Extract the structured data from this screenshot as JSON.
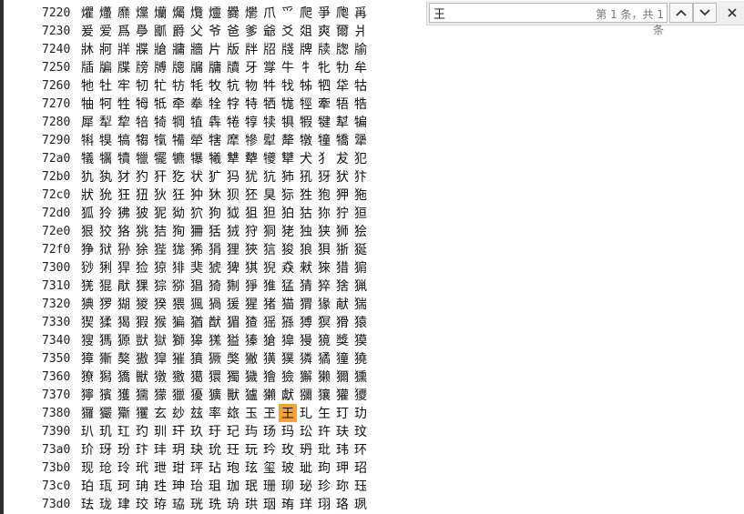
{
  "find_bar": {
    "query": "王",
    "match_count": "第 1 条，共 1 条",
    "icons": {
      "prev": "chevron-up-icon",
      "next": "chevron-down-icon",
      "close": "close-icon"
    }
  },
  "highlight_color": "#f6a23a",
  "table": {
    "rows": [
      {
        "code": "7220",
        "chars": [
          "爠",
          "爡",
          "爢",
          "爣",
          "爤",
          "爥",
          "爦",
          "爧",
          "爨",
          "爩",
          "爪",
          "爫",
          "爬",
          "爭",
          "爮",
          "爯"
        ]
      },
      {
        "code": "7230",
        "chars": [
          "爰",
          "爱",
          "爲",
          "爳",
          "爴",
          "爵",
          "父",
          "爷",
          "爸",
          "爹",
          "爺",
          "爻",
          "爼",
          "爽",
          "爾",
          "爿"
        ]
      },
      {
        "code": "7240",
        "chars": [
          "牀",
          "牁",
          "牂",
          "牃",
          "牄",
          "牅",
          "牆",
          "片",
          "版",
          "牉",
          "牊",
          "牋",
          "牌",
          "牍",
          "牎",
          "牏"
        ]
      },
      {
        "code": "7250",
        "chars": [
          "牐",
          "牑",
          "牒",
          "牓",
          "牔",
          "牕",
          "牖",
          "牗",
          "牘",
          "牙",
          "牚",
          "牛",
          "牜",
          "牝",
          "牞",
          "牟"
        ]
      },
      {
        "code": "7260",
        "chars": [
          "牠",
          "牡",
          "牢",
          "牣",
          "牤",
          "牥",
          "牦",
          "牧",
          "牨",
          "物",
          "牪",
          "牫",
          "牬",
          "牭",
          "牮",
          "牯"
        ]
      },
      {
        "code": "7270",
        "chars": [
          "牰",
          "牱",
          "牲",
          "牳",
          "牴",
          "牵",
          "牶",
          "牷",
          "牸",
          "特",
          "牺",
          "牻",
          "牼",
          "牽",
          "牾",
          "牿"
        ]
      },
      {
        "code": "7280",
        "chars": [
          "犀",
          "犁",
          "犂",
          "犃",
          "犄",
          "犅",
          "犆",
          "犇",
          "犈",
          "犉",
          "犊",
          "犋",
          "犌",
          "犍",
          "犎",
          "犏"
        ]
      },
      {
        "code": "7290",
        "chars": [
          "犐",
          "犑",
          "犒",
          "犓",
          "犔",
          "犕",
          "犖",
          "犗",
          "犘",
          "犙",
          "犚",
          "犛",
          "犜",
          "犝",
          "犞",
          "犟"
        ]
      },
      {
        "code": "72a0",
        "chars": [
          "犠",
          "犡",
          "犢",
          "犣",
          "犤",
          "犥",
          "犦",
          "犧",
          "犨",
          "犩",
          "犪",
          "犫",
          "犬",
          "犭",
          "犮",
          "犯"
        ]
      },
      {
        "code": "72b0",
        "chars": [
          "犰",
          "犱",
          "犲",
          "犳",
          "犴",
          "犵",
          "状",
          "犷",
          "犸",
          "犹",
          "犺",
          "犻",
          "犼",
          "犽",
          "犾",
          "犿"
        ]
      },
      {
        "code": "72c0",
        "chars": [
          "狀",
          "狁",
          "狂",
          "狃",
          "狄",
          "狅",
          "狆",
          "狇",
          "狈",
          "狉",
          "狊",
          "狋",
          "狌",
          "狍",
          "狎",
          "狏"
        ]
      },
      {
        "code": "72d0",
        "chars": [
          "狐",
          "狑",
          "狒",
          "狓",
          "狔",
          "狕",
          "狖",
          "狗",
          "狘",
          "狙",
          "狚",
          "狛",
          "狜",
          "狝",
          "狞",
          "狟"
        ]
      },
      {
        "code": "72e0",
        "chars": [
          "狠",
          "狡",
          "狢",
          "狣",
          "狤",
          "狥",
          "狦",
          "狧",
          "狨",
          "狩",
          "狪",
          "狫",
          "独",
          "狭",
          "狮",
          "狯"
        ]
      },
      {
        "code": "72f0",
        "chars": [
          "狰",
          "狱",
          "狲",
          "狳",
          "狴",
          "狵",
          "狶",
          "狷",
          "狸",
          "狹",
          "狺",
          "狻",
          "狼",
          "狽",
          "狾",
          "狿"
        ]
      },
      {
        "code": "7300",
        "chars": [
          "猀",
          "猁",
          "猂",
          "猃",
          "猄",
          "猅",
          "猆",
          "猇",
          "猈",
          "猉",
          "猊",
          "猋",
          "猌",
          "猍",
          "猎",
          "猏"
        ]
      },
      {
        "code": "7310",
        "chars": [
          "猐",
          "猑",
          "猒",
          "猓",
          "猔",
          "猕",
          "猖",
          "猗",
          "猘",
          "猙",
          "猚",
          "猛",
          "猜",
          "猝",
          "猞",
          "猟"
        ]
      },
      {
        "code": "7320",
        "chars": [
          "猠",
          "猡",
          "猢",
          "猣",
          "猤",
          "猥",
          "猦",
          "猧",
          "猨",
          "猩",
          "猪",
          "猫",
          "猬",
          "猭",
          "献",
          "猯"
        ]
      },
      {
        "code": "7330",
        "chars": [
          "猰",
          "猱",
          "猲",
          "猳",
          "猴",
          "猵",
          "猶",
          "猷",
          "猸",
          "猹",
          "猺",
          "猻",
          "猼",
          "猽",
          "猾",
          "猿"
        ]
      },
      {
        "code": "7340",
        "chars": [
          "獀",
          "獁",
          "獂",
          "獃",
          "獄",
          "獅",
          "獆",
          "獇",
          "獈",
          "獉",
          "獊",
          "獋",
          "獌",
          "獍",
          "獎",
          "獏"
        ]
      },
      {
        "code": "7350",
        "chars": [
          "獐",
          "獑",
          "獒",
          "獓",
          "獔",
          "獕",
          "獖",
          "獗",
          "獘",
          "獙",
          "獚",
          "獛",
          "獜",
          "獝",
          "獞",
          "獟"
        ]
      },
      {
        "code": "7360",
        "chars": [
          "獠",
          "獡",
          "獢",
          "獣",
          "獤",
          "獥",
          "獦",
          "獧",
          "獨",
          "獩",
          "獪",
          "獫",
          "獬",
          "獭",
          "獮",
          "獯"
        ]
      },
      {
        "code": "7370",
        "chars": [
          "獰",
          "獱",
          "獲",
          "獳",
          "獴",
          "獵",
          "獶",
          "獷",
          "獸",
          "獹",
          "獺",
          "獻",
          "獼",
          "獽",
          "獾",
          "獿"
        ]
      },
      {
        "code": "7380",
        "chars": [
          "玀",
          "玁",
          "玂",
          "玃",
          "玄",
          "玅",
          "玆",
          "率",
          "玈",
          "玉",
          "玊",
          "王",
          "玌",
          "玍",
          "玎",
          "玏"
        ]
      },
      {
        "code": "7390",
        "chars": [
          "玐",
          "玑",
          "玒",
          "玓",
          "玔",
          "玕",
          "玖",
          "玗",
          "玘",
          "玙",
          "玚",
          "玛",
          "玜",
          "玝",
          "玞",
          "玟"
        ]
      },
      {
        "code": "73a0",
        "chars": [
          "玠",
          "玡",
          "玢",
          "玣",
          "玤",
          "玥",
          "玦",
          "玧",
          "玨",
          "玩",
          "玪",
          "玫",
          "玬",
          "玭",
          "玮",
          "环"
        ]
      },
      {
        "code": "73b0",
        "chars": [
          "现",
          "玱",
          "玲",
          "玳",
          "玴",
          "玵",
          "玶",
          "玷",
          "玸",
          "玹",
          "玺",
          "玻",
          "玼",
          "玽",
          "玾",
          "玿"
        ]
      },
      {
        "code": "73c0",
        "chars": [
          "珀",
          "珁",
          "珂",
          "珃",
          "珄",
          "珅",
          "珆",
          "珇",
          "珈",
          "珉",
          "珊",
          "珋",
          "珌",
          "珍",
          "珎",
          "珏"
        ]
      },
      {
        "code": "73d0",
        "chars": [
          "珐",
          "珑",
          "珒",
          "珓",
          "珔",
          "珕",
          "珖",
          "珗",
          "珘",
          "珙",
          "珚",
          "珛",
          "珜",
          "珝",
          "珞",
          "珟"
        ]
      }
    ],
    "highlight": {
      "row": 22,
      "col": 11
    }
  }
}
